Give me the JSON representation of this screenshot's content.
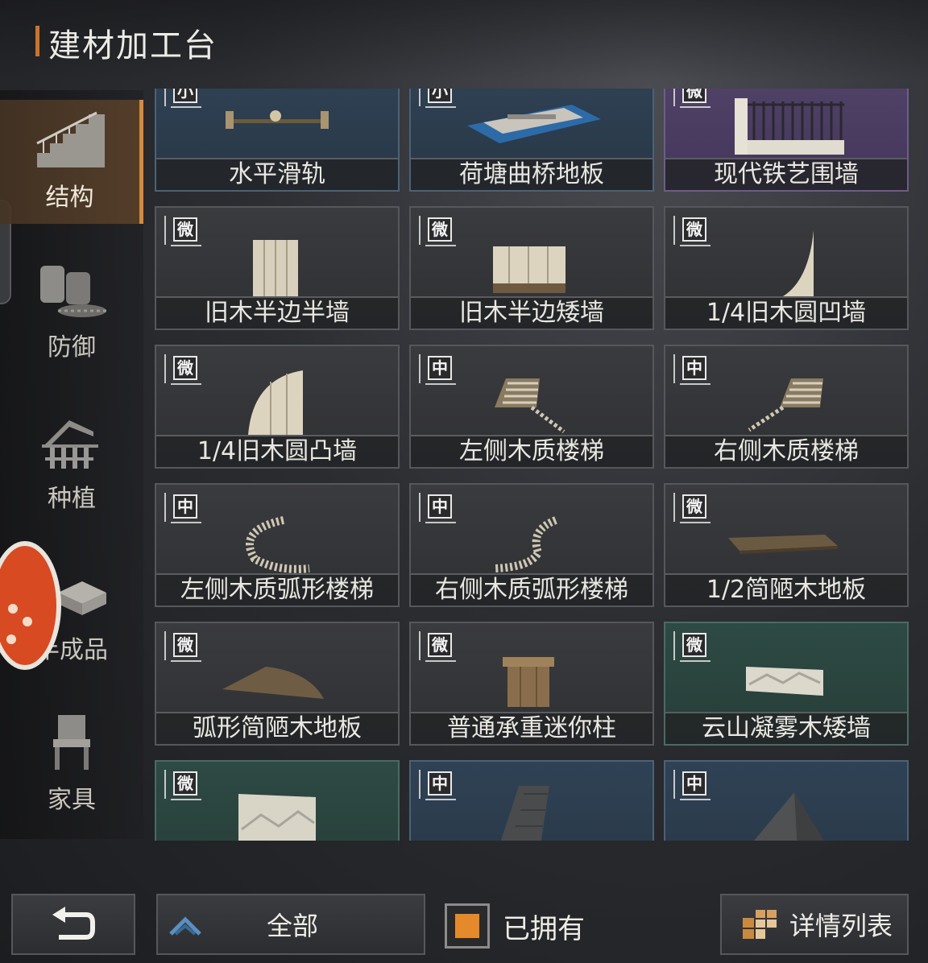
{
  "header": {
    "title": "建材加工台"
  },
  "sidebar": {
    "categories": [
      {
        "label": "结构",
        "icon": "stairs-icon"
      },
      {
        "label": "防御",
        "icon": "barricade-icon"
      },
      {
        "label": "种植",
        "icon": "farm-icon"
      },
      {
        "label": "半成品",
        "icon": "materials-icon"
      },
      {
        "label": "家具",
        "icon": "chair-icon"
      }
    ],
    "active": "结构"
  },
  "items": [
    {
      "name": "水平滑轨",
      "size": "小",
      "tint": "blue"
    },
    {
      "name": "荷塘曲桥地板",
      "size": "小",
      "tint": "blue"
    },
    {
      "name": "现代铁艺围墙",
      "size": "微",
      "tint": "purple"
    },
    {
      "name": "旧木半边半墙",
      "size": "微",
      "tint": "gray"
    },
    {
      "name": "旧木半边矮墙",
      "size": "微",
      "tint": "gray"
    },
    {
      "name": "1/4旧木圆凹墙",
      "size": "微",
      "tint": "gray"
    },
    {
      "name": "1/4旧木圆凸墙",
      "size": "微",
      "tint": "gray"
    },
    {
      "name": "左侧木质楼梯",
      "size": "中",
      "tint": "gray"
    },
    {
      "name": "右侧木质楼梯",
      "size": "中",
      "tint": "gray"
    },
    {
      "name": "左侧木质弧形楼梯",
      "size": "中",
      "tint": "gray"
    },
    {
      "name": "右侧木质弧形楼梯",
      "size": "中",
      "tint": "gray"
    },
    {
      "name": "1/2简陋木地板",
      "size": "微",
      "tint": "gray"
    },
    {
      "name": "弧形简陋木地板",
      "size": "微",
      "tint": "gray"
    },
    {
      "name": "普通承重迷你柱",
      "size": "微",
      "tint": "gray"
    },
    {
      "name": "云山凝雾木矮墙",
      "size": "微",
      "tint": "green"
    },
    {
      "name": "",
      "size": "微",
      "tint": "green"
    },
    {
      "name": "",
      "size": "中",
      "tint": "blue"
    },
    {
      "name": "",
      "size": "中",
      "tint": "blue"
    }
  ],
  "footer": {
    "back_icon": "return-arrow-icon",
    "filter_label": "全部",
    "filter_icon": "chevron-up-icon",
    "owned_label": "已拥有",
    "owned_checked": true,
    "detail_label": "详情列表",
    "detail_icon": "grid-list-icon"
  },
  "colors": {
    "accent": "#d48a3c",
    "checkbox_fill": "#e58a2a",
    "fab": "#d84a22"
  }
}
